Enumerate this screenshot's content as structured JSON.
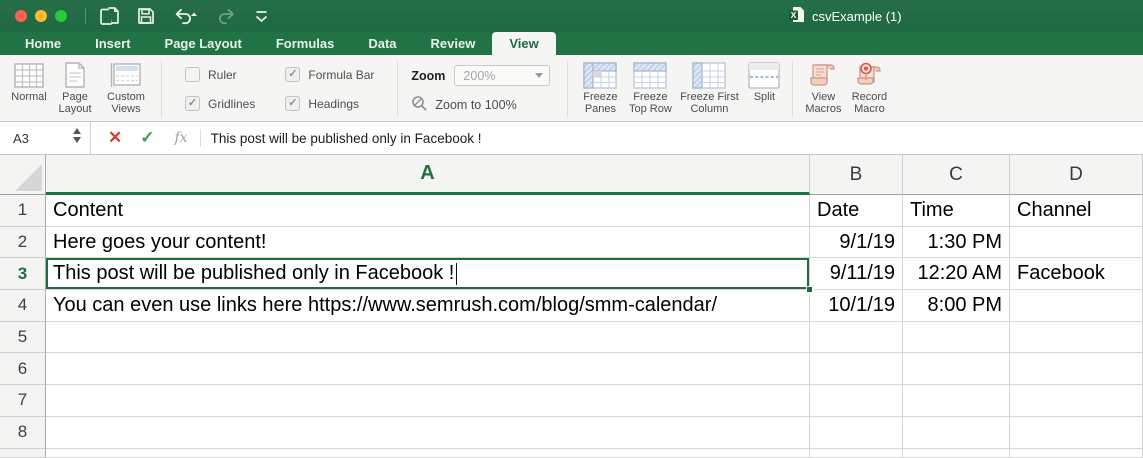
{
  "window": {
    "title": "csvExample (1)"
  },
  "titlebar_icons": [
    "new-workbook-icon",
    "save-icon",
    "undo-icon",
    "redo-icon",
    "customize-toolbar-icon"
  ],
  "tabs": {
    "items": [
      "Home",
      "Insert",
      "Page Layout",
      "Formulas",
      "Data",
      "Review",
      "View"
    ],
    "active": "View"
  },
  "ribbon": {
    "view_buttons": [
      {
        "label": "Normal"
      },
      {
        "label": "Page Layout"
      },
      {
        "label": "Custom Views"
      }
    ],
    "checkboxes": [
      {
        "label": "Ruler",
        "checked": false,
        "mark": ""
      },
      {
        "label": "Gridlines",
        "checked": true,
        "mark": "✓"
      },
      {
        "label": "Formula Bar",
        "checked": true,
        "mark": "✓"
      },
      {
        "label": "Headings",
        "checked": true,
        "mark": "✓"
      }
    ],
    "zoom": {
      "label": "Zoom",
      "value": "200%",
      "zoom_to_100": "Zoom to 100%"
    },
    "window_buttons": [
      {
        "label": "Freeze Panes"
      },
      {
        "label": "Freeze Top Row"
      },
      {
        "label": "Freeze First Column"
      },
      {
        "label": "Split"
      }
    ],
    "macro_buttons": [
      {
        "label": "View Macros"
      },
      {
        "label": "Record Macro"
      }
    ]
  },
  "formula_bar": {
    "name_box": "A3",
    "cancel_glyph": "✕",
    "enter_glyph": "✓",
    "fx_label": "fx",
    "formula": "This post will be published only in Facebook !"
  },
  "sheet": {
    "selected_cell": "A3",
    "col_headers": [
      "A",
      "B",
      "C",
      "D"
    ],
    "row_headers": [
      "1",
      "2",
      "3",
      "4",
      "5",
      "6",
      "7",
      "8"
    ],
    "rows": [
      [
        "Content",
        "Date",
        "Time",
        "Channel"
      ],
      [
        "Here goes your content!",
        "9/1/19",
        "1:30 PM",
        ""
      ],
      [
        "This post will be published only in Facebook !",
        "9/11/19",
        "12:20 AM",
        "Facebook"
      ],
      [
        "You can even use links here https://www.semrush.com/blog/smm-calendar/",
        "10/1/19",
        "8:00 PM",
        ""
      ],
      [
        "",
        "",
        "",
        ""
      ],
      [
        "",
        "",
        "",
        ""
      ],
      [
        "",
        "",
        "",
        ""
      ],
      [
        "",
        "",
        "",
        ""
      ]
    ]
  },
  "colors": {
    "excel_green": "#217346",
    "title_green": "#1f6b43",
    "selection_border": "#1e6b41"
  }
}
